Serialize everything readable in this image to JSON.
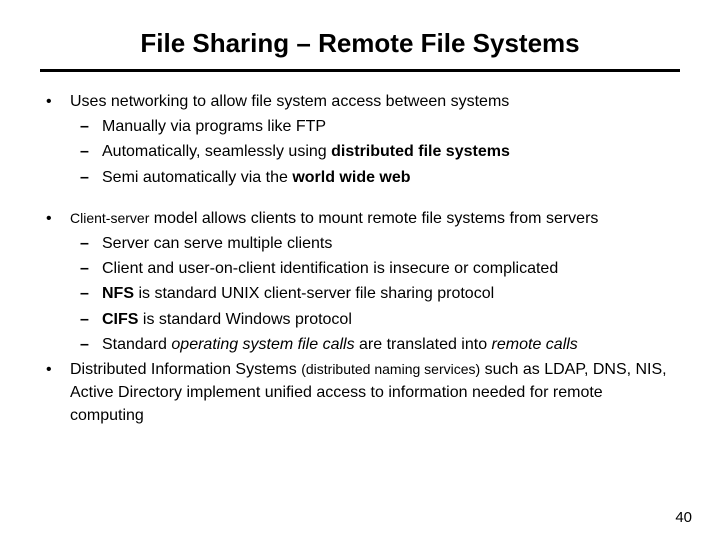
{
  "title": "File Sharing – Remote File Systems",
  "page_number": "40",
  "b1": {
    "main_a": "Uses networking to allow file system access between systems",
    "s1_a": "Manually via programs like FTP",
    "s2_a": "Automatically, seamlessly using ",
    "s2_b": "distributed file systems",
    "s3_a": "Semi automatically via the ",
    "s3_b": "world wide web"
  },
  "b2": {
    "main_a": "Client-server",
    "main_b": " model allows clients to mount remote file systems from servers",
    "s1_a": "Server can serve multiple clients",
    "s2_a": "Client and user-on-client identification is insecure or complicated",
    "s3_a": "NFS",
    "s3_b": " is standard UNIX client-server file sharing protocol",
    "s4_a": "CIFS",
    "s4_b": " is standard Windows protocol",
    "s5_a": "Standard ",
    "s5_b": "operating system file calls",
    "s5_c": " are translated into ",
    "s5_d": "remote calls"
  },
  "b3": {
    "a": "Distributed Information Systems ",
    "b": "(distributed naming services)",
    "c": " such as LDAP, DNS, NIS, Active Directory implement unified access to information needed for remote computing"
  }
}
